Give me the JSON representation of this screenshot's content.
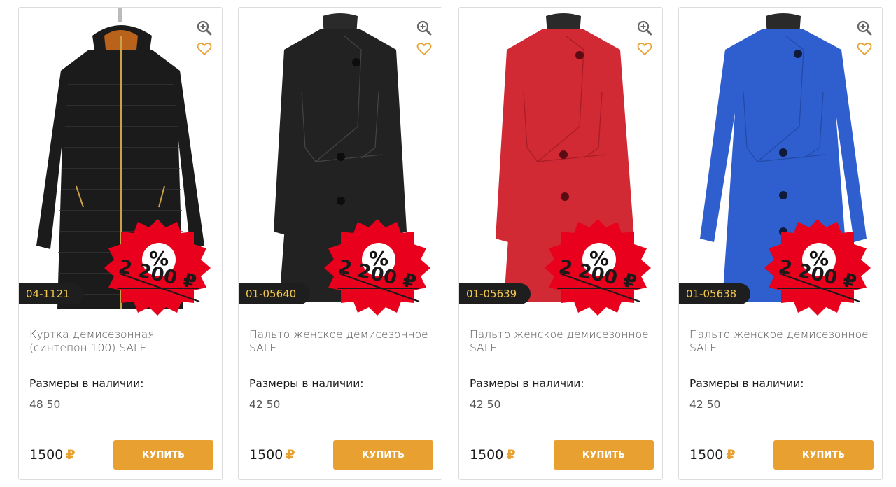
{
  "currency_symbol": "₽",
  "buy_label": "КУПИТЬ",
  "sizes_label": "Размеры в наличии:",
  "discount_sign": "%",
  "colors": {
    "accent": "#e8a030",
    "sale_red": "#e8001c",
    "sku_bg": "#1e1e1e",
    "sku_text": "#f2c94c"
  },
  "products": [
    {
      "sku": "04-1121",
      "title": "Куртка демисезонная (синтепон 100) SALE",
      "sizes": "48 50",
      "price": "1500",
      "old_price": "2 200 ₽",
      "garment_color": "#1b1b1b"
    },
    {
      "sku": "01-05640",
      "title": "Пальто женское демисезонное SALE",
      "sizes": "42 50",
      "price": "1500",
      "old_price": "2 200 ₽",
      "garment_color": "#222222"
    },
    {
      "sku": "01-05639",
      "title": "Пальто женское демисезонное SALE",
      "sizes": "42 50",
      "price": "1500",
      "old_price": "2 200 ₽",
      "garment_color": "#d12a35"
    },
    {
      "sku": "01-05638",
      "title": "Пальто женское демисезонное SALE",
      "sizes": "42 50",
      "price": "1500",
      "old_price": "2 200 ₽",
      "garment_color": "#2f5fcf"
    }
  ]
}
